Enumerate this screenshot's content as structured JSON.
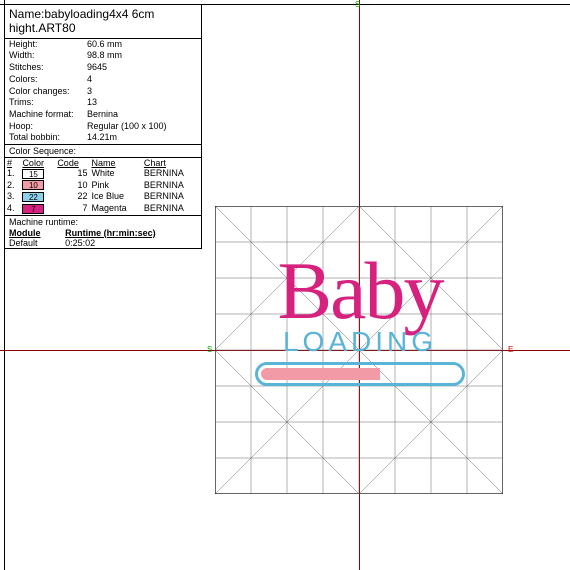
{
  "title": "Name:babyloading4x4 6cm hight.ART80",
  "meta": {
    "height_lbl": "Height:",
    "height": "60.6 mm",
    "width_lbl": "Width:",
    "width": "98.8 mm",
    "stitches_lbl": "Stitches:",
    "stitches": "9645",
    "colors_lbl": "Colors:",
    "colors": "4",
    "changes_lbl": "Color changes:",
    "changes": "3",
    "trims_lbl": "Trims:",
    "trims": "13",
    "format_lbl": "Machine format:",
    "format": "Bernina",
    "hoop_lbl": "Hoop:",
    "hoop": "Regular (100 x 100)",
    "bobbin_lbl": "Total bobbin:",
    "bobbin": "14.21m"
  },
  "colorseq_lbl": "Color Sequence:",
  "color_hdr": {
    "n": "#",
    "col": "Color",
    "code": "Code",
    "name": "Name",
    "chart": "Chart"
  },
  "colors_rows": [
    {
      "n": "1.",
      "swatch": "15",
      "bg": "#ffffff",
      "code": "15",
      "name": "White",
      "chart": "BERNINA"
    },
    {
      "n": "2.",
      "swatch": "10",
      "bg": "#f29aa6",
      "code": "10",
      "name": "Pink",
      "chart": "BERNINA"
    },
    {
      "n": "3.",
      "swatch": "22",
      "bg": "#8cd0ea",
      "code": "22",
      "name": "Ice Blue",
      "chart": "BERNINA"
    },
    {
      "n": "4.",
      "swatch": "7",
      "bg": "#d6227e",
      "code": "7",
      "name": "Magenta",
      "chart": "BERNINA"
    }
  ],
  "runtime_lbl": "Machine runtime:",
  "runtime_hdr": {
    "mod": "Module",
    "rt": "Runtime (hr:min:sec)"
  },
  "runtime_row": {
    "mod": "Default",
    "rt": "0:25:02"
  },
  "design": {
    "baby": "Baby",
    "loading": "LOADING"
  },
  "marks": {
    "s": "S",
    "e": "E"
  }
}
